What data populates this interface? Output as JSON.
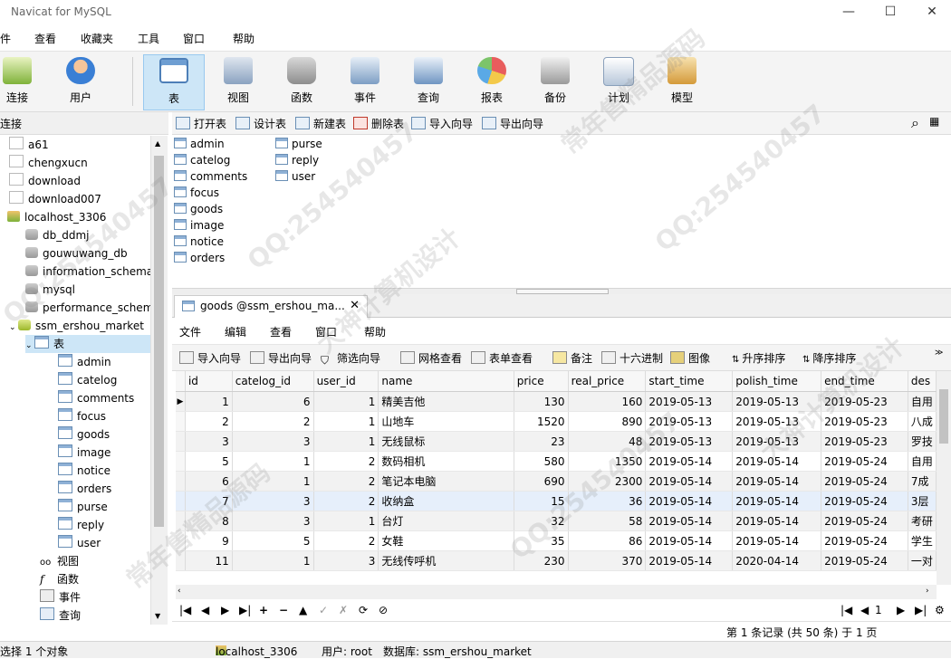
{
  "window": {
    "title": "Navicat for MySQL",
    "minimize": "—",
    "maximize": "☐",
    "close": "✕"
  },
  "menu": [
    "件",
    "查看",
    "收藏夹",
    "工具",
    "窗口",
    "帮助"
  ],
  "toolbar": [
    "连接",
    "用户",
    "表",
    "视图",
    "函数",
    "事件",
    "查询",
    "报表",
    "备份",
    "计划",
    "模型"
  ],
  "connection_header": "连接",
  "tree": {
    "connections": [
      "a61",
      "chengxucn",
      "download",
      "download007"
    ],
    "localhost": "localhost_3306",
    "databases": [
      "db_ddmj",
      "gouwuwang_db",
      "information_schema",
      "mysql",
      "performance_schem",
      "ssm_ershou_market"
    ],
    "tables_node": "表",
    "tables": [
      "admin",
      "catelog",
      "comments",
      "focus",
      "goods",
      "image",
      "notice",
      "orders",
      "purse",
      "reply",
      "user"
    ],
    "other_nodes": [
      "视图",
      "函数",
      "事件",
      "查询"
    ]
  },
  "object_toolbar": [
    "打开表",
    "设计表",
    "新建表",
    "删除表",
    "导入向导",
    "导出向导"
  ],
  "objects": [
    "admin",
    "catelog",
    "comments",
    "focus",
    "goods",
    "image",
    "notice",
    "orders",
    "purse",
    "reply",
    "user"
  ],
  "tab": {
    "label": "goods @ssm_ershou_ma...",
    "close": "✕"
  },
  "inner_menu": [
    "文件",
    "编辑",
    "查看",
    "窗口",
    "帮助"
  ],
  "inner_toolbar": [
    "导入向导",
    "导出向导",
    "筛选向导",
    "网格查看",
    "表单查看",
    "备注",
    "十六进制",
    "图像",
    "升序排序",
    "降序排序"
  ],
  "grid": {
    "columns": [
      "id",
      "catelog_id",
      "user_id",
      "name",
      "price",
      "real_price",
      "start_time",
      "polish_time",
      "end_time",
      "des"
    ],
    "rows": [
      [
        "1",
        "6",
        "1",
        "精美吉他",
        "130",
        "160",
        "2019-05-13",
        "2019-05-13",
        "2019-05-23",
        "自用"
      ],
      [
        "2",
        "2",
        "1",
        "山地车",
        "1520",
        "890",
        "2019-05-13",
        "2019-05-13",
        "2019-05-23",
        "八成"
      ],
      [
        "3",
        "3",
        "1",
        "无线鼠标",
        "23",
        "48",
        "2019-05-13",
        "2019-05-13",
        "2019-05-23",
        "罗技"
      ],
      [
        "5",
        "1",
        "2",
        "数码相机",
        "580",
        "1350",
        "2019-05-14",
        "2019-05-14",
        "2019-05-24",
        "自用"
      ],
      [
        "6",
        "1",
        "2",
        "笔记本电脑",
        "690",
        "2300",
        "2019-05-14",
        "2019-05-14",
        "2019-05-24",
        "7成"
      ],
      [
        "7",
        "3",
        "2",
        "收纳盒",
        "15",
        "36",
        "2019-05-14",
        "2019-05-14",
        "2019-05-24",
        "3层"
      ],
      [
        "8",
        "3",
        "1",
        "台灯",
        "32",
        "58",
        "2019-05-14",
        "2019-05-14",
        "2019-05-24",
        "考研"
      ],
      [
        "9",
        "5",
        "2",
        "女鞋",
        "35",
        "86",
        "2019-05-14",
        "2019-05-14",
        "2019-05-24",
        "学生"
      ],
      [
        "11",
        "1",
        "3",
        "无线传呼机",
        "230",
        "370",
        "2019-05-14",
        "2020-04-14",
        "2019-05-24",
        "一对"
      ]
    ]
  },
  "nav": {
    "buttons": [
      "|◀",
      "◀",
      "▶",
      "▶|",
      "+",
      "−",
      "▲",
      "✓",
      "✗",
      "⟳",
      "⊘"
    ],
    "page": "1"
  },
  "record_info": "第 1 条记录 (共 50 条) 于 1 页",
  "status": {
    "selection": "选择 1 个对象",
    "connection": "localhost_3306",
    "user": "用户: root",
    "database": "数据库: ssm_ershou_market"
  },
  "watermark": [
    "常年售精品源码",
    "QQ:254540457",
    "大神计算机设计"
  ]
}
